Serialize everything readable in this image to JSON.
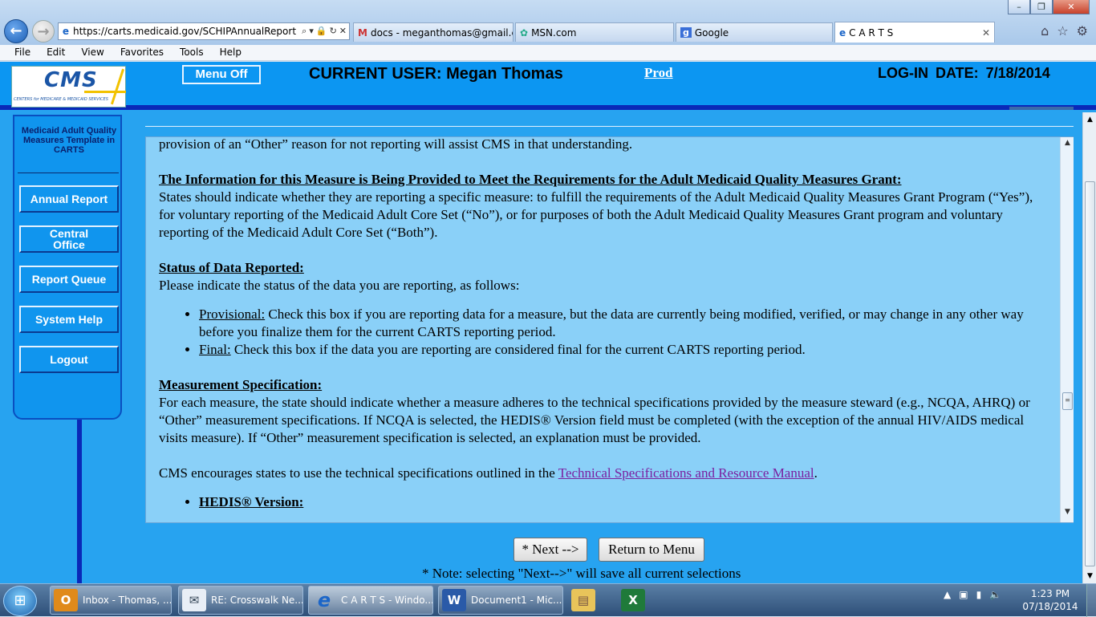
{
  "browser": {
    "address": "https://carts.medicaid.gov/SCHIPAnnualReport",
    "tabs": [
      {
        "label": "docs - meganthomas@gmail.c...",
        "icon": "gmail-icon"
      },
      {
        "label": "MSN.com",
        "icon": "msn-icon"
      },
      {
        "label": "Google",
        "icon": "google-icon"
      },
      {
        "label": "C A R T S",
        "icon": "ie-icon",
        "active": true
      }
    ],
    "menu": [
      "File",
      "Edit",
      "View",
      "Favorites",
      "Tools",
      "Help"
    ]
  },
  "header": {
    "logo_text": "CMS",
    "logo_subtext": "CENTERS for MEDICARE & MEDICAID SERVICES",
    "menu_off": "Menu Off",
    "current_user": "CURRENT USER: Megan Thomas",
    "prod": "Prod",
    "login_date": "LOG-IN DATE:  7/18/2014"
  },
  "nav": {
    "title": "Medicaid Adult Quality Measures Template in CARTS",
    "items": [
      "Annual Report",
      "Central Office",
      "Report Queue",
      "System Help",
      "Logout"
    ]
  },
  "content": {
    "p0": "provision of an “Other” reason for not reporting will assist CMS in that understanding.",
    "h1": "The Information for this Measure is Being Provided to Meet the Requirements for the Adult Medicaid Quality Measures Grant:",
    "p1": "States should indicate whether they are reporting a specific measure: to fulfill the requirements of the Adult Medicaid Quality Measures Grant Program (“Yes”), for voluntary reporting of the Medicaid Adult Core Set (“No”), or for purposes of both the Adult Medicaid Quality Measures Grant program and voluntary reporting of the Medicaid Adult Core Set (“Both”).",
    "h2": "Status of Data Reported:",
    "p2": "Please indicate the status of the data you are reporting, as follows:",
    "b1_label": "Provisional:",
    "b1_text": " Check this box if you are reporting data for a measure, but the data are currently being modified, verified, or may change in any other way before you finalize them for the current CARTS reporting period.",
    "b2_label": "Final:",
    "b2_text": " Check this box if the data you are reporting are considered final for the current CARTS reporting period.",
    "h3": "Measurement Specification:",
    "p3": "For each measure, the state should indicate whether a measure adheres to the technical specifications provided by the measure steward (e.g., NCQA, AHRQ) or “Other” measurement specifications. If NCQA is selected, the HEDIS® Version field must be completed (with the exception of the annual HIV/AIDS medical visits measure). If “Other” measurement specification is selected, an explanation must be provided.",
    "p4_pre": "CMS encourages states to use the technical specifications outlined in the ",
    "p4_link": "Technical Specifications and Resource Manual",
    "p4_post": ".",
    "b3_label": "HEDIS® Version:"
  },
  "buttons": {
    "next": "* Next -->",
    "return": "Return to Menu",
    "note": "* Note: selecting \"Next-->\" will save all current selections"
  },
  "taskbar": {
    "items": [
      {
        "label": "Inbox - Thomas, ...",
        "icon": "outlook-icon"
      },
      {
        "label": "RE: Crosswalk Ne...",
        "icon": "email-icon"
      },
      {
        "label": "C A R T S - Windo...",
        "icon": "ie-icon",
        "active": true
      },
      {
        "label": "Document1 - Mic...",
        "icon": "word-icon"
      },
      {
        "label": "",
        "icon": "folder-icon"
      },
      {
        "label": "",
        "icon": "excel-icon"
      }
    ],
    "time": "1:23 PM",
    "date": "07/18/2014"
  }
}
